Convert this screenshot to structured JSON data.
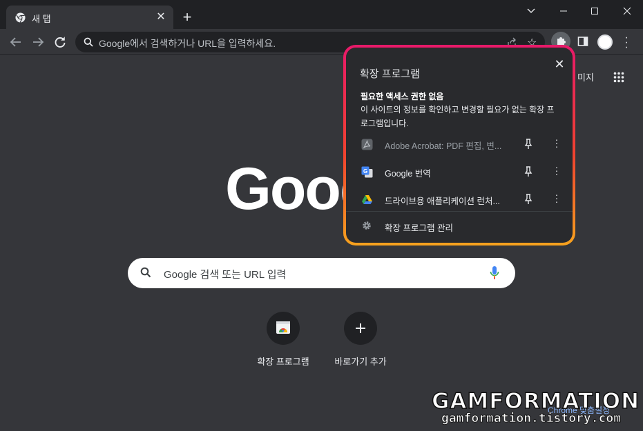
{
  "tab": {
    "title": "새 탭",
    "close": "✕"
  },
  "new_tab": "+",
  "omnibox": {
    "placeholder": "Google에서 검색하거나 URL을 입력하세요."
  },
  "ntp": {
    "images_link": "미지",
    "search_placeholder": "Google 검색 또는 URL 입력",
    "logo_text": "Goog",
    "shortcuts": [
      {
        "label": "확장 프로그램"
      },
      {
        "label": "바로가기 추가"
      }
    ],
    "customize": "Chrome 맞춤설정"
  },
  "popup": {
    "title": "확장 프로그램",
    "heading": "필요한 액세스 권한 없음",
    "description": "이 사이트의 정보를 확인하고 변경할 필요가 없는 확장 프로그램입니다.",
    "extensions": [
      {
        "name": "Adobe Acrobat: PDF 편집, 변...",
        "dim": true
      },
      {
        "name": "Google 번역",
        "dim": false
      },
      {
        "name": "드라이브용 애플리케이션 런처...",
        "dim": false
      }
    ],
    "manage": "확장 프로그램 관리"
  },
  "watermark": {
    "line1": "GAMFORMATION",
    "line2": "gamformation.tistory.com"
  },
  "colors": {
    "highlight_top": "#e8196a",
    "highlight_bottom": "#f6a21e",
    "page_bg": "#35363a",
    "popup_bg": "#292a2d"
  }
}
